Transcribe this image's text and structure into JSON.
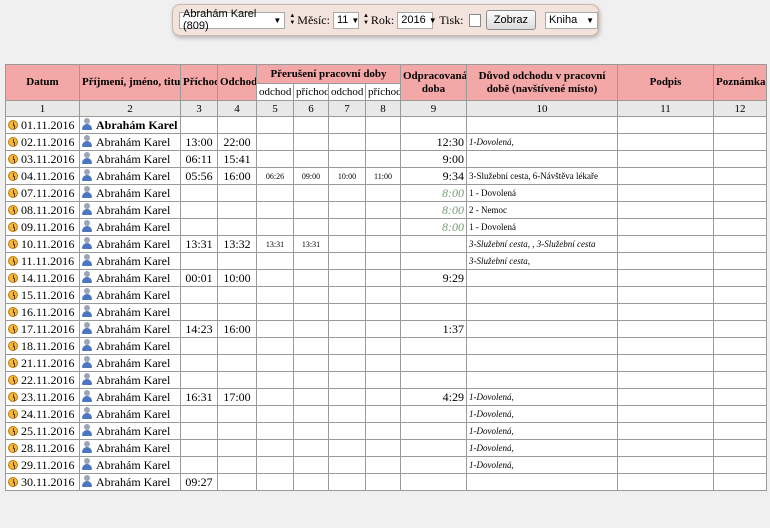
{
  "filter": {
    "employee": "Abrahám Karel (809)",
    "month_label": "Měsíc:",
    "month": "11",
    "year_label": "Rok:",
    "year": "2016",
    "print_label": "Tisk:",
    "show_button": "Zobraz",
    "view": "Kniha"
  },
  "header": {
    "date": "Datum",
    "name": "Příjmení, jméno, titul",
    "arrival": "Příchod",
    "departure": "Odchod",
    "interruption": "Přerušení pracovní doby",
    "leave1": "odchod",
    "return1": "příchod",
    "leave2": "odchod",
    "return2": "příchod",
    "worked": "Odpracovaná doba",
    "reason": "Důvod odchodu v pracovní době (navštívené místo)",
    "signature": "Podpis",
    "note": "Poznámka"
  },
  "col_numbers": [
    "1",
    "2",
    "3",
    "4",
    "5",
    "6",
    "7",
    "8",
    "9",
    "10",
    "11",
    "12"
  ],
  "rows": [
    {
      "date": "01.11.2016",
      "name": "Abrahám Karel",
      "bold": true,
      "in": "",
      "out": "",
      "o1": "",
      "p1": "",
      "o2": "",
      "p2": "",
      "worked": "",
      "reason": ""
    },
    {
      "date": "02.11.2016",
      "name": "Abrahám Karel",
      "in": "13:00",
      "out": "22:00",
      "o1": "",
      "p1": "",
      "o2": "",
      "p2": "",
      "worked": "12:30",
      "reason": "1-Dovolená,",
      "reason_italic": true
    },
    {
      "date": "03.11.2016",
      "name": "Abrahám Karel",
      "in": "06:11",
      "out": "15:41",
      "o1": "",
      "p1": "",
      "o2": "",
      "p2": "",
      "worked": "9:00",
      "reason": ""
    },
    {
      "date": "04.11.2016",
      "name": "Abrahám Karel",
      "in": "05:56",
      "out": "16:00",
      "o1": "06:26",
      "p1": "09:00",
      "o2": "10:00",
      "p2": "11:00",
      "worked": "9:34",
      "reason": "3-Služební cesta, 6-Návštěva lékaře"
    },
    {
      "date": "07.11.2016",
      "name": "Abrahám Karel",
      "in": "",
      "out": "",
      "o1": "",
      "p1": "",
      "o2": "",
      "p2": "",
      "worked": "8:00",
      "worked_green": true,
      "reason": "1 - Dovolená"
    },
    {
      "date": "08.11.2016",
      "name": "Abrahám Karel",
      "in": "",
      "out": "",
      "o1": "",
      "p1": "",
      "o2": "",
      "p2": "",
      "worked": "8:00",
      "worked_green": true,
      "reason": "2 - Nemoc"
    },
    {
      "date": "09.11.2016",
      "name": "Abrahám Karel",
      "in": "",
      "out": "",
      "o1": "",
      "p1": "",
      "o2": "",
      "p2": "",
      "worked": "8:00",
      "worked_green": true,
      "reason": "1 - Dovolená"
    },
    {
      "date": "10.11.2016",
      "name": "Abrahám Karel",
      "in": "13:31",
      "out": "13:32",
      "o1": "13:31",
      "p1": "13:31",
      "o2": "",
      "p2": "",
      "worked": "",
      "reason": "3-Služební cesta, , 3-Služební cesta",
      "reason_mixed": true
    },
    {
      "date": "11.11.2016",
      "name": "Abrahám Karel",
      "in": "",
      "out": "",
      "o1": "",
      "p1": "",
      "o2": "",
      "p2": "",
      "worked": "",
      "reason": "3-Služební cesta,",
      "reason_italic": true
    },
    {
      "date": "14.11.2016",
      "name": "Abrahám Karel",
      "in": "00:01",
      "out": "10:00",
      "o1": "",
      "p1": "",
      "o2": "",
      "p2": "",
      "worked": "9:29",
      "reason": ""
    },
    {
      "date": "15.11.2016",
      "name": "Abrahám Karel",
      "in": "",
      "out": "",
      "o1": "",
      "p1": "",
      "o2": "",
      "p2": "",
      "worked": "",
      "reason": ""
    },
    {
      "date": "16.11.2016",
      "name": "Abrahám Karel",
      "in": "",
      "out": "",
      "o1": "",
      "p1": "",
      "o2": "",
      "p2": "",
      "worked": "",
      "reason": ""
    },
    {
      "date": "17.11.2016",
      "name": "Abrahám Karel",
      "in": "14:23",
      "out": "16:00",
      "o1": "",
      "p1": "",
      "o2": "",
      "p2": "",
      "worked": "1:37",
      "reason": ""
    },
    {
      "date": "18.11.2016",
      "name": "Abrahám Karel",
      "in": "",
      "out": "",
      "o1": "",
      "p1": "",
      "o2": "",
      "p2": "",
      "worked": "",
      "reason": ""
    },
    {
      "date": "21.11.2016",
      "name": "Abrahám Karel",
      "in": "",
      "out": "",
      "o1": "",
      "p1": "",
      "o2": "",
      "p2": "",
      "worked": "",
      "reason": ""
    },
    {
      "date": "22.11.2016",
      "name": "Abrahám Karel",
      "in": "",
      "out": "",
      "o1": "",
      "p1": "",
      "o2": "",
      "p2": "",
      "worked": "",
      "reason": ""
    },
    {
      "date": "23.11.2016",
      "name": "Abrahám Karel",
      "in": "16:31",
      "out": "17:00",
      "o1": "",
      "p1": "",
      "o2": "",
      "p2": "",
      "worked": "4:29",
      "reason": "1-Dovolená,",
      "reason_italic": true
    },
    {
      "date": "24.11.2016",
      "name": "Abrahám Karel",
      "in": "",
      "out": "",
      "o1": "",
      "p1": "",
      "o2": "",
      "p2": "",
      "worked": "",
      "reason": "1-Dovolená,",
      "reason_italic": true
    },
    {
      "date": "25.11.2016",
      "name": "Abrahám Karel",
      "in": "",
      "out": "",
      "o1": "",
      "p1": "",
      "o2": "",
      "p2": "",
      "worked": "",
      "reason": "1-Dovolená,",
      "reason_italic": true
    },
    {
      "date": "28.11.2016",
      "name": "Abrahám Karel",
      "in": "",
      "out": "",
      "o1": "",
      "p1": "",
      "o2": "",
      "p2": "",
      "worked": "",
      "reason": "1-Dovolená,",
      "reason_italic": true
    },
    {
      "date": "29.11.2016",
      "name": "Abrahám Karel",
      "in": "",
      "out": "",
      "o1": "",
      "p1": "",
      "o2": "",
      "p2": "",
      "worked": "",
      "reason": "1-Dovolená,",
      "reason_italic": true
    },
    {
      "date": "30.11.2016",
      "name": "Abrahám Karel",
      "in": "09:27",
      "out": "",
      "o1": "",
      "p1": "",
      "o2": "",
      "p2": "",
      "worked": "",
      "reason": ""
    }
  ]
}
